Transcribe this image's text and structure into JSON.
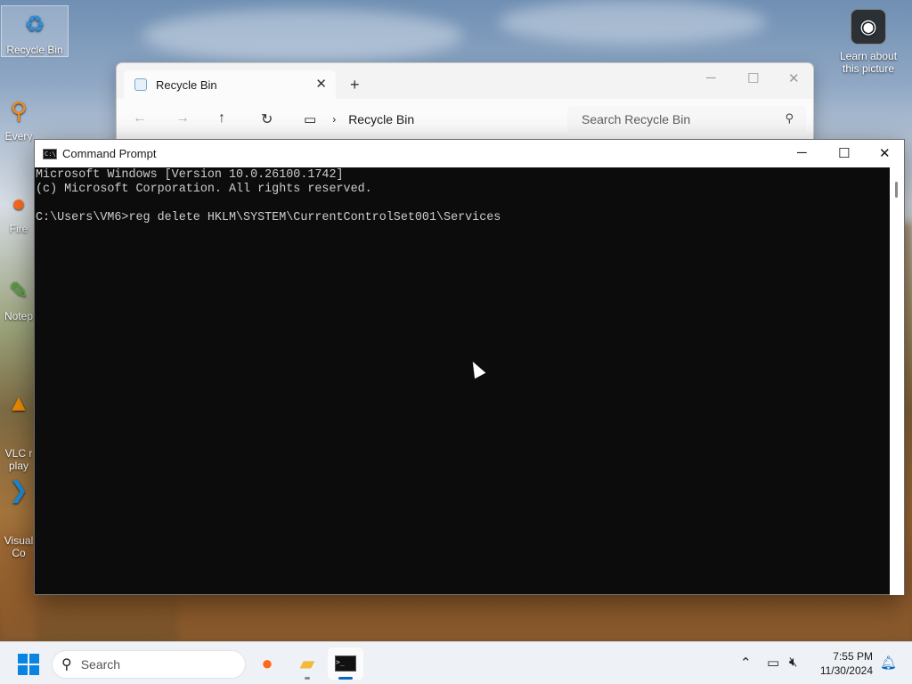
{
  "desktop": {
    "icons": [
      {
        "label": "Recycle Bin",
        "icon": "recycle-bin-icon"
      },
      {
        "label": "Every",
        "icon": "everything-search-icon"
      },
      {
        "label": "Fire",
        "icon": "firefox-icon"
      },
      {
        "label": "Notep",
        "icon": "notepad-plus-plus-icon"
      },
      {
        "label": "VLC r\nplay",
        "icon": "vlc-icon"
      },
      {
        "label": "Visual\nCo",
        "icon": "vscode-icon"
      }
    ],
    "learn_about": "Learn about\nthis picture"
  },
  "explorer": {
    "tab_label": "Recycle Bin",
    "address": "Recycle Bin",
    "search_placeholder": "Search Recycle Bin"
  },
  "cmd": {
    "title": "Command Prompt",
    "lines": [
      "Microsoft Windows [Version 10.0.26100.1742]",
      "(c) Microsoft Corporation. All rights reserved.",
      "",
      "C:\\Users\\VM6>reg delete HKLM\\SYSTEM\\CurrentControlSet001\\Services"
    ]
  },
  "taskbar": {
    "search_placeholder": "Search",
    "time": "7:55 PM",
    "date": "11/30/2024",
    "accent": "#0a66c2"
  }
}
